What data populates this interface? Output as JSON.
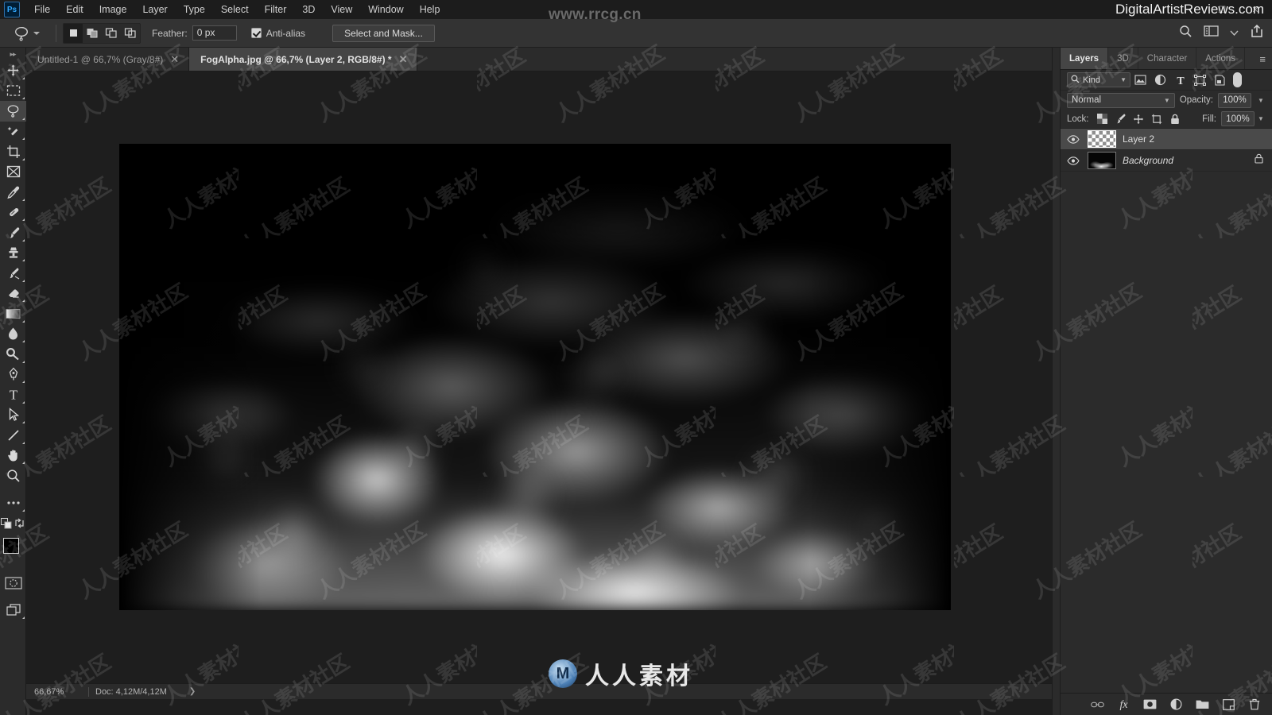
{
  "app": {
    "logo_label": "Ps",
    "window_controls": [
      "–",
      "❐",
      "✕"
    ]
  },
  "menubar": {
    "items": [
      {
        "label": "File"
      },
      {
        "label": "Edit"
      },
      {
        "label": "Image"
      },
      {
        "label": "Layer"
      },
      {
        "label": "Type"
      },
      {
        "label": "Select"
      },
      {
        "label": "Filter"
      },
      {
        "label": "3D"
      },
      {
        "label": "View"
      },
      {
        "label": "Window"
      },
      {
        "label": "Help"
      }
    ]
  },
  "options_bar": {
    "active_tool": "lasso-tool",
    "selection_modes": [
      {
        "name": "new-selection",
        "active": true
      },
      {
        "name": "add-to-selection",
        "active": false
      },
      {
        "name": "subtract-from-selection",
        "active": false
      },
      {
        "name": "intersect-with-selection",
        "active": false
      }
    ],
    "feather_label": "Feather:",
    "feather_value": "0 px",
    "antialias_label": "Anti-alias",
    "antialias_checked": true,
    "select_and_mask_label": "Select and Mask...",
    "right_icons": [
      "search-icon",
      "workspace-icon",
      "chevron-down-icon",
      "share-icon"
    ]
  },
  "toolbar": {
    "expand_label": "▸▸",
    "tools": [
      {
        "name": "move-tool",
        "glyph": "move"
      },
      {
        "name": "rectangular-marquee-tool",
        "glyph": "marquee"
      },
      {
        "name": "lasso-tool",
        "glyph": "lasso",
        "active": true
      },
      {
        "name": "quick-selection-tool",
        "glyph": "wand"
      },
      {
        "name": "crop-tool",
        "glyph": "crop"
      },
      {
        "name": "frame-tool",
        "glyph": "frame"
      },
      {
        "name": "eyedropper-tool",
        "glyph": "eyedropper"
      },
      {
        "name": "spot-healing-brush-tool",
        "glyph": "heal"
      },
      {
        "name": "brush-tool",
        "glyph": "brush"
      },
      {
        "name": "clone-stamp-tool",
        "glyph": "stamp"
      },
      {
        "name": "history-brush-tool",
        "glyph": "historybrush"
      },
      {
        "name": "eraser-tool",
        "glyph": "eraser"
      },
      {
        "name": "gradient-tool",
        "glyph": "gradient"
      },
      {
        "name": "blur-tool",
        "glyph": "blur"
      },
      {
        "name": "dodge-tool",
        "glyph": "dodge"
      },
      {
        "name": "pen-tool",
        "glyph": "pen"
      },
      {
        "name": "horizontal-type-tool",
        "glyph": "type"
      },
      {
        "name": "path-selection-tool",
        "glyph": "pathselect"
      },
      {
        "name": "line-tool",
        "glyph": "line"
      },
      {
        "name": "hand-tool",
        "glyph": "hand"
      },
      {
        "name": "zoom-tool",
        "glyph": "zoom"
      },
      {
        "name": "edit-toolbar-tool",
        "glyph": "ellipsis"
      }
    ],
    "foreground_color": "#000000",
    "background_color": "#ffffff",
    "quick_mask_name": "quick-mask-toggle",
    "screen_mode_name": "screen-mode-toggle"
  },
  "document_tabs": [
    {
      "title": "Untitled-1 @ 66,7% (Gray/8#)",
      "active": false,
      "close": "✕"
    },
    {
      "title": "FogAlpha.jpg @ 66,7% (Layer 2, RGB/8#) *",
      "active": true,
      "close": "✕"
    }
  ],
  "status_bar": {
    "zoom": "66,67%",
    "doc_info": "Doc: 4,12M/4,12M",
    "arrow": "❯"
  },
  "layers_panel": {
    "tabs": [
      {
        "label": "Layers",
        "active": true
      },
      {
        "label": "3D",
        "active": false
      },
      {
        "label": "Character",
        "active": false
      },
      {
        "label": "Actions",
        "active": false
      }
    ],
    "menu_icon": "≡",
    "filter": {
      "kind_label": "Kind",
      "search_icon": "search-icon",
      "icons": [
        "pixel-filter-icon",
        "adjustment-filter-icon",
        "type-filter-icon",
        "shape-filter-icon",
        "smartobject-filter-icon"
      ],
      "toggle_name": "filter-enable-toggle"
    },
    "blend_mode": "Normal",
    "opacity_label": "Opacity:",
    "opacity_value": "100%",
    "lock_label": "Lock:",
    "lock_icons": [
      "lock-transparent-pixels-icon",
      "lock-image-pixels-icon",
      "lock-position-icon",
      "lock-artboard-icon",
      "lock-all-icon"
    ],
    "fill_label": "Fill:",
    "fill_value": "100%",
    "layers": [
      {
        "name": "Layer 2",
        "visible": true,
        "selected": true,
        "thumb": "checker",
        "locked": false,
        "italic": false
      },
      {
        "name": "Background",
        "visible": true,
        "selected": false,
        "thumb": "fog",
        "locked": true,
        "italic": true
      }
    ],
    "footer_icons": [
      {
        "name": "link-layers-icon",
        "glyph": "GD"
      },
      {
        "name": "layer-style-icon",
        "glyph": "fx"
      },
      {
        "name": "layer-mask-icon",
        "glyph": "mask"
      },
      {
        "name": "adjustment-layer-icon",
        "glyph": "halfcircle"
      },
      {
        "name": "new-group-icon",
        "glyph": "folder"
      },
      {
        "name": "new-layer-icon",
        "glyph": "newlayer"
      },
      {
        "name": "delete-layer-icon",
        "glyph": "trash"
      }
    ]
  },
  "watermarks": {
    "top_center": "www.rrcg.cn",
    "top_right": "DigitalArtistReviews.com",
    "bottom_logo_glyph": "Μ",
    "bottom_text": "人人素材",
    "tile_text": "人人素材社区"
  },
  "canvas": {
    "document_name": "FogAlpha.jpg",
    "zoom_percent": "66,67%"
  }
}
